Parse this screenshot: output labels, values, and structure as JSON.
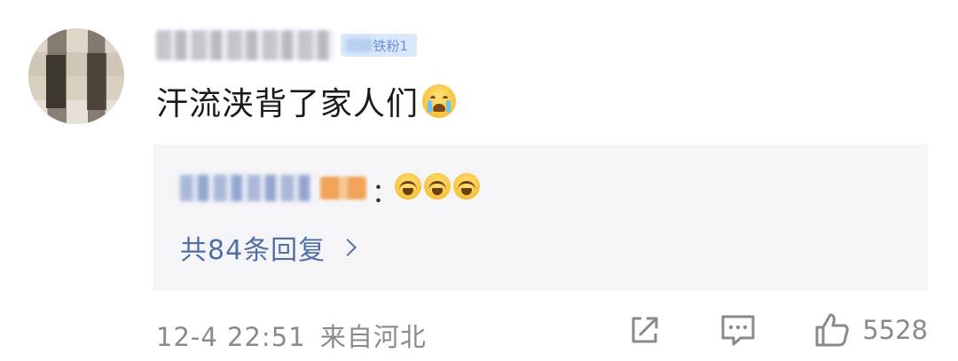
{
  "comment": {
    "fan_badge": "铁粉1",
    "text": "汗流浃背了家人们",
    "emoji": "cry-emoji"
  },
  "reply_preview": {
    "colon": "：",
    "emojis": [
      "laugh-cry-emoji",
      "laugh-cry-emoji",
      "laugh-cry-emoji"
    ],
    "reply_count_label": "共84条回复"
  },
  "footer": {
    "timestamp": "12-4 22:51",
    "location": "来自河北",
    "share_icon": "share-icon",
    "comment_icon": "comment-icon",
    "like_icon": "thumbs-up-icon",
    "like_count": "5528"
  },
  "colors": {
    "link_blue": "#4f6fa6",
    "meta_gray": "#8a8a8a",
    "reply_bg": "#f5f5f7",
    "badge_bg": "#d9e8fb"
  }
}
